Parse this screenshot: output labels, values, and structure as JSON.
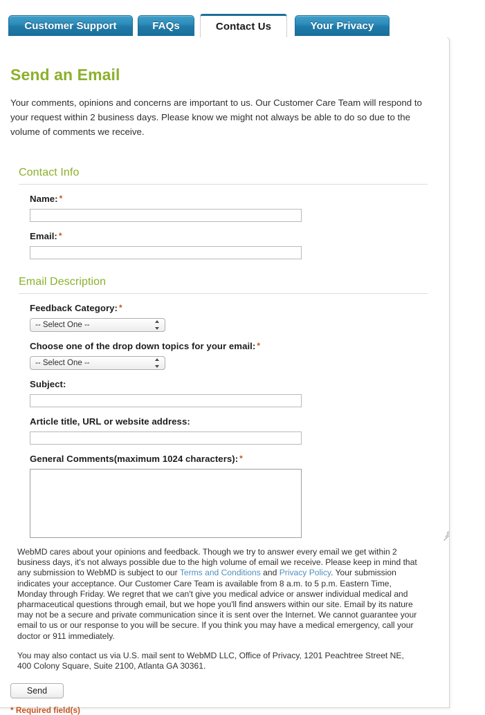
{
  "tabs": [
    {
      "label": "Customer Support",
      "active": false
    },
    {
      "label": "FAQs",
      "active": false
    },
    {
      "label": "Contact Us",
      "active": true
    },
    {
      "label": "Your Privacy",
      "active": false
    }
  ],
  "page": {
    "title": "Send an Email",
    "intro": "Your comments, opinions and concerns are important to us. Our Customer Care Team will respond to your request within 2 business days. Please know we might not always be able to do so due to the volume of comments we receive."
  },
  "sections": {
    "contact_info": {
      "heading": "Contact Info",
      "fields": {
        "name": {
          "label": "Name:",
          "required": true,
          "value": "",
          "placeholder": ""
        },
        "email": {
          "label": "Email:",
          "required": true,
          "value": "",
          "placeholder": ""
        }
      }
    },
    "email_description": {
      "heading": "Email Description",
      "fields": {
        "feedback_category": {
          "label": "Feedback Category:",
          "required": true,
          "selected": "-- Select One --",
          "options": [
            "-- Select One --"
          ]
        },
        "topic": {
          "label": "Choose one of the drop down topics for your email:",
          "required": true,
          "selected": "-- Select One --",
          "options": [
            "-- Select One --"
          ]
        },
        "subject": {
          "label": "Subject:",
          "required": false,
          "value": "",
          "placeholder": ""
        },
        "article": {
          "label": "Article title, URL or website address:",
          "required": false,
          "value": "",
          "placeholder": ""
        },
        "comments": {
          "label": "General Comments(maximum 1024 characters):",
          "required": true,
          "value": "",
          "placeholder": ""
        }
      }
    }
  },
  "legal": {
    "paragraph1_part1": "WebMD cares about your opinions and feedback. Though we try to answer every email we get within 2 business days, it's not always possible due to the high volume of email we receive. Please keep in mind that any submission to WebMD is subject to our ",
    "link_terms": "Terms and Conditions",
    "paragraph1_part2": " and ",
    "link_privacy": "Privacy Policy",
    "paragraph1_part3": ". Your submission indicates your acceptance. Our Customer Care Team is available from 8 a.m. to 5 p.m. Eastern Time, Monday through Friday. We regret that we can't give you medical advice or answer individual medical and pharmaceutical questions through email, but we hope you'll find answers within our site. Email by its nature may not be a secure and private communication since it is sent over the Internet. We cannot guarantee your email to us or our response to you will be secure. If you think you may have a medical emergency, call your doctor or 911 immediately.",
    "paragraph2": "You may also contact us via U.S. mail sent to WebMD LLC, Office of Privacy, 1201 Peachtree Street NE, 400 Colony Square, Suite 2100, Atlanta GA 30361."
  },
  "footer": {
    "send_label": "Send",
    "required_note": "* Required field(s)",
    "asterisk": "*"
  },
  "colors": {
    "heading_green": "#8cb02b",
    "tab_blue": "#1f7aa8",
    "required_orange": "#c4561f",
    "link_blue": "#4f8fc0"
  }
}
